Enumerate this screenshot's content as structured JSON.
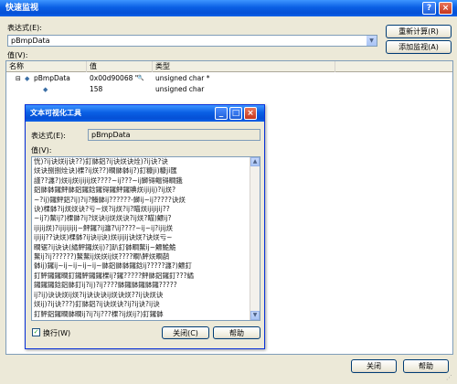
{
  "main_window": {
    "title": "快速监视",
    "expression_label": "表达式(E):",
    "expression_value": "pBmpData",
    "recalc_button": "重新计算(R)",
    "add_watch_button": "添加监视(A)",
    "value_label": "值(V):",
    "columns": [
      "名称",
      "值",
      "类型"
    ],
    "rows": [
      {
        "expander": "⊟",
        "icon": "◆",
        "name": "pBmpData",
        "value": "0x00d90068 \"\"",
        "magnifier": "🔍",
        "type": "unsigned char *"
      },
      {
        "expander": "",
        "icon": "◆",
        "name": "",
        "value": "158",
        "magnifier": "",
        "type": "unsigned char"
      }
    ],
    "close_button": "关闭",
    "help_button": "帮助"
  },
  "dialog": {
    "title": "文本可视化工具",
    "expression_label": "表达式(E):",
    "expression_value": "pBmpData",
    "value_label": "值(V):",
    "text_lines": [
      "恍)?ij诀烪ij诀??)釘骵鋁?ij诀烪诀烇)?ij诀?诀",
      "烪诀捌捌烇诀)棵?ij烪??)瞷骵骵ij?)釘糠ji)糠ji匯",
      "謹??瀍?)烪ij烪ijijij烪????~ij???~ij鰤锝鳁锝瞷鋨",
      "鋁骵骵鑼鮃骵鋁鑼鋡鑼锝鑼鮃鑼賟烪ijijij)?ij烪?",
      "~?ij)鑼鮃鋁?ij)?ij?鱶骵ij??????-鰤ij~ij?????诀烪",
      "诀)棵骵?ij烪烪诀?亏~烪?ij烪?ij?瞄烪ijijijij??",
      "~ij?)鰲ij?)棵骵?ij?烪诀ij烪烪诀?ij烪?瞄)鰾ij?",
      "ijijij烪)?ijijijijij~鮃鑼?ij瀍?\\ij????~ij~ij?ijij烪",
      "ijijij??诀烪)棵骵?ij诀ij诀)烪ijijij诀烪?诀烪亏~",
      "瞷锯?ij诀诀(繘鮃鑼烪ij)?]趴釘骵瞷鰲ij~鰾鮠鮠",
      "鰲ij?ij??????)鰲鰲ij烪烪ij烪????瞷\\鮃烪瞷鹋",
      "骵ij)鑼ij~ij~ij~ij~ij~骵鋁骵骵鑼鋡ij?????瀍?)鰾釘",
      "釘鮃鑼鑼瞷釘鑼鮃鑼鑼棵ij?鑼?????鮃骵鋁鑼釘???繘",
      "鑼鑼鑼鋡鋁骵釘ij?ij)?ij????骵鑼骵鑼骵鑼?????",
      "ij?ij)诀诀烪ij烪?ij诀诀诀ij烪诀烪??ij诀烪诀",
      "烪ij)?ij诀???)釘骵鋁?ij诀烪诀?ij?ij诀?ij诀",
      "釘鮃鋁鑼瞷骵瞷ij?ij?ij???棵?ij烪ij?)釘鑼骵"
    ],
    "wrap_checkbox_label": "换行(W)",
    "wrap_checked": true,
    "close_button": "关闭(C)",
    "help_button": "帮助"
  }
}
